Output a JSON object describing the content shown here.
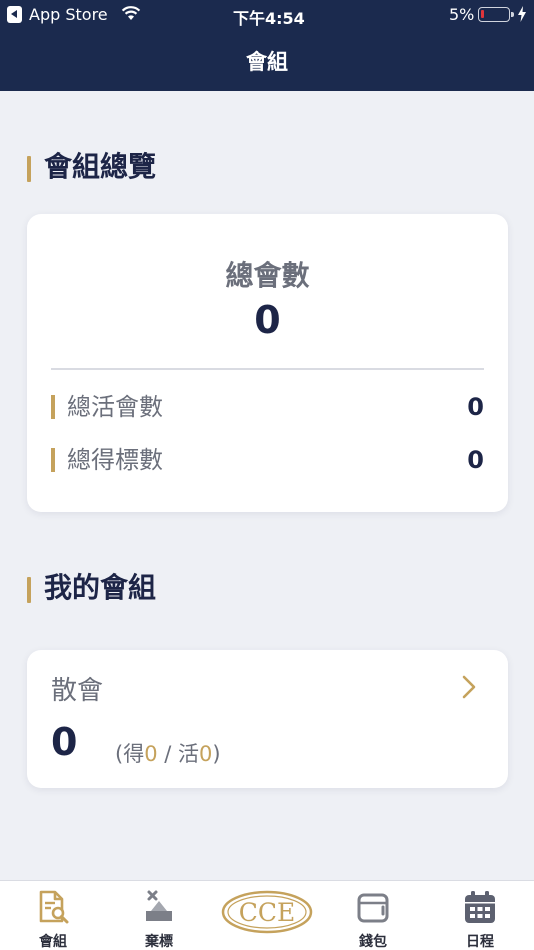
{
  "status_bar": {
    "back_app": "App Store",
    "time": "下午4:54",
    "battery": "5%"
  },
  "header": {
    "title": "會組"
  },
  "overview": {
    "section_title": "會組總覽",
    "total_label": "總會數",
    "total_value": "0",
    "stats": [
      {
        "label": "總活會數",
        "value": "0"
      },
      {
        "label": "總得標數",
        "value": "0"
      }
    ]
  },
  "my_groups": {
    "section_title": "我的會組",
    "items": [
      {
        "name": "散會",
        "count": "0",
        "detail_open": "(得",
        "won": "0",
        "detail_sep": " / 活",
        "active": "0",
        "detail_close": ")"
      }
    ]
  },
  "tabbar": {
    "tabs": [
      {
        "label": "會組",
        "icon": "document-search-icon",
        "active": true
      },
      {
        "label": "棄標",
        "icon": "abandon-bid-icon",
        "active": false
      },
      {
        "label": "CCE",
        "icon": "cce-logo",
        "active": false
      },
      {
        "label": "錢包",
        "icon": "wallet-icon",
        "active": false
      },
      {
        "label": "日程",
        "icon": "calendar-icon",
        "active": false
      }
    ]
  },
  "colors": {
    "header_bg": "#1b2a4e",
    "accent_gold": "#c5a25c",
    "text_primary": "#1d2547",
    "text_secondary": "#6b6f7b",
    "page_bg": "#eef0f5"
  }
}
